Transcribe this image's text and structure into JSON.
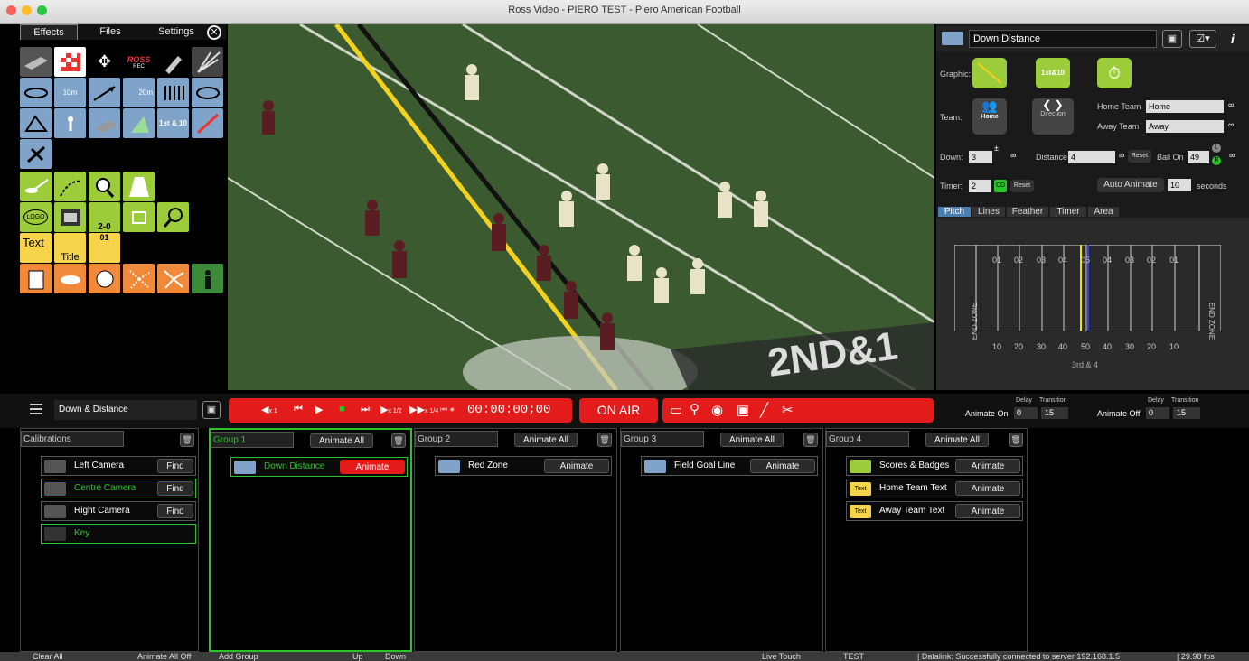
{
  "window": {
    "title": "Ross Video - PIERO TEST - Piero American Football"
  },
  "left_tabs": [
    "Effects",
    "Files",
    "Settings"
  ],
  "tiles": {
    "rec": "REC",
    "ross": "ROSS",
    "m10": "10m",
    "m20": "20m",
    "fd": "1st & 10",
    "logo": "LOGO",
    "score": "2-0",
    "text": "Text",
    "title": "Title",
    "num": "01"
  },
  "right_panel": {
    "graphic_name": "Down Distance",
    "graphic_label": "Graphic:",
    "graphic_fd": "1st&10",
    "team_label": "Team:",
    "home_btn": "Home",
    "direction_btn": "Direction",
    "home_team_label": "Home Team",
    "home_team_value": "Home",
    "away_team_label": "Away Team",
    "away_team_value": "Away",
    "down_label": "Down:",
    "down_value": "3",
    "distance_label": "Distance",
    "distance_value": "4",
    "reset1": "Reset",
    "ball_on_label": "Ball On",
    "ball_on_value": "49",
    "lr_l": "L",
    "lr_r": "R",
    "timer_label": "Timer:",
    "timer_value": "2",
    "timer_badge": "CD",
    "reset2": "Reset",
    "auto_animate": "Auto Animate",
    "auto_value": "10",
    "seconds": "seconds",
    "tabs": [
      "Pitch",
      "Lines",
      "Feather",
      "Timer",
      "Area"
    ],
    "end_zone_left": "END ZONE",
    "end_zone_right": "END ZONE",
    "yard_top": [
      "01",
      "02",
      "03",
      "04",
      "05",
      "04",
      "03",
      "02",
      "01"
    ],
    "yard_bottom": [
      "10",
      "20",
      "30",
      "40",
      "50",
      "40",
      "30",
      "20",
      "10"
    ],
    "pitch_caption": "3rd & 4"
  },
  "toolbar": {
    "preset": "Down & Distance",
    "timecode": "00:00:00;00",
    "on_air": "ON AIR",
    "speed_x1": "x 1",
    "speed_half": "x 1/2",
    "speed_quarter": "x 1/4"
  },
  "animate_on": {
    "label": "Animate On",
    "delay_label": "Delay",
    "transition_label": "Transition",
    "delay": "0",
    "transition": "15"
  },
  "animate_off": {
    "label": "Animate Off",
    "delay_label": "Delay",
    "transition_label": "Transition",
    "delay": "0",
    "transition": "15"
  },
  "calibrations": {
    "title": "Calibrations",
    "items": [
      {
        "label": "Left Camera",
        "find": "Find"
      },
      {
        "label": "Centre Camera",
        "find": "Find"
      },
      {
        "label": "Right Camera",
        "find": "Find"
      },
      {
        "label": "Key"
      }
    ]
  },
  "groups": [
    {
      "name": "Group 1",
      "animate_all": "Animate All",
      "items": [
        {
          "label": "Down Distance",
          "animate": "Animate"
        }
      ]
    },
    {
      "name": "Group 2",
      "animate_all": "Animate All",
      "items": [
        {
          "label": "Red Zone",
          "animate": "Animate"
        }
      ]
    },
    {
      "name": "Group 3",
      "animate_all": "Animate All",
      "items": [
        {
          "label": "Field Goal Line",
          "animate": "Animate"
        }
      ]
    },
    {
      "name": "Group 4",
      "animate_all": "Animate All",
      "items": [
        {
          "label": "Scores & Badges",
          "animate": "Animate"
        },
        {
          "label": "Home Team Text",
          "animate": "Animate",
          "icon": "Text"
        },
        {
          "label": "Away Team Text",
          "animate": "Animate",
          "icon": "Text"
        }
      ]
    }
  ],
  "statusbar": {
    "clear_all": "Clear All",
    "animate_all_off": "Animate All Off",
    "add_group": "Add Group",
    "up": "Up",
    "down": "Down",
    "live_touch": "Live Touch",
    "test": "TEST",
    "datalink": "| Datalink: Successfully connected to server 192.168.1.5",
    "fps": "| 29.98 fps"
  },
  "colors": {
    "red": "#e31b1b",
    "green_active": "#29c429",
    "tile_blue": "#7fa3c9",
    "tile_green": "#9ccc3a",
    "tile_orange": "#f08a3a",
    "tile_yellow": "#f5d44b"
  }
}
